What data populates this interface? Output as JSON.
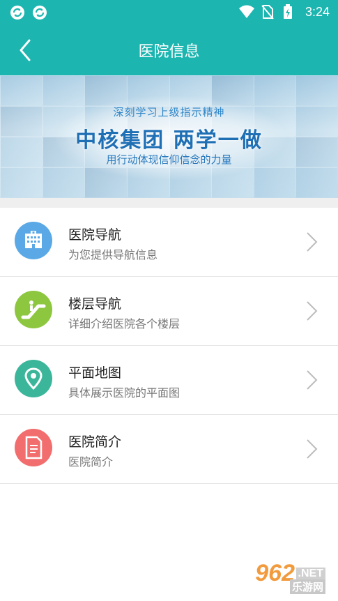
{
  "status_bar": {
    "time": "3:24"
  },
  "header": {
    "title": "医院信息"
  },
  "banner": {
    "line1": "深刻学习上级指示精神",
    "line2": "中核集团  两学一做",
    "line3": "用行动体现信仰信念的力量"
  },
  "menu": [
    {
      "label": "医院导航",
      "subtitle": "为您提供导航信息",
      "icon": "hospital-building-icon",
      "color": "#5aa9e6"
    },
    {
      "label": "楼层导航",
      "subtitle": "详细介绍医院各个楼层",
      "icon": "escalator-icon",
      "color": "#8dc63f"
    },
    {
      "label": "平面地图",
      "subtitle": "具体展示医院的平面图",
      "icon": "map-pin-icon",
      "color": "#3bb69a"
    },
    {
      "label": "医院简介",
      "subtitle": "医院简介",
      "icon": "document-icon",
      "color": "#f26d6d"
    }
  ],
  "watermark": {
    "number": "962",
    "net": ".NET",
    "cn": "乐游网"
  },
  "colors": {
    "primary": "#1cb5b0"
  }
}
